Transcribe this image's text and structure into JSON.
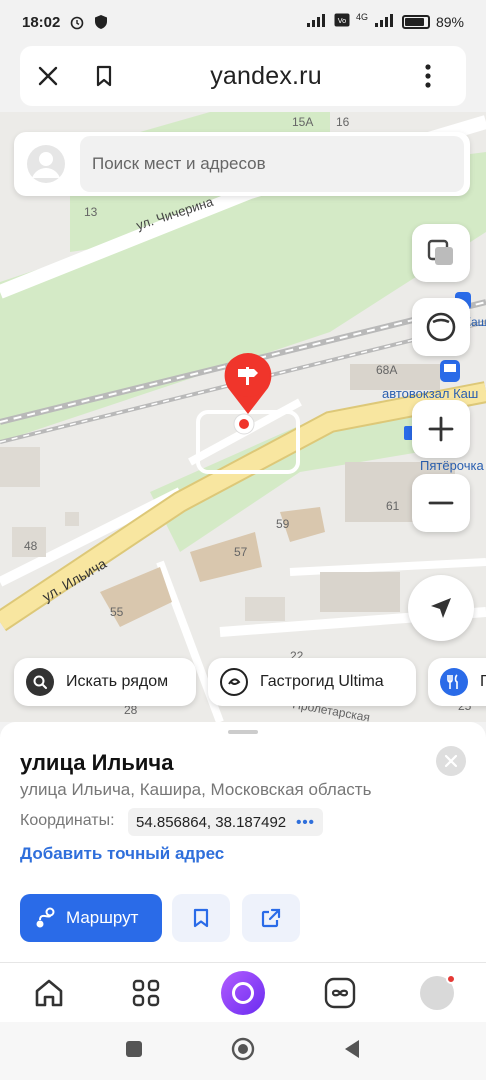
{
  "status_bar": {
    "time": "18:02",
    "network": "4G",
    "battery": "89%"
  },
  "browser": {
    "url": "yandex.ru"
  },
  "search": {
    "placeholder": "Поиск мест и адресов"
  },
  "map": {
    "labels": {
      "house_15a": "15А",
      "house_16": "16",
      "house_13": "13",
      "street_chicherina": "ул. Чичерина",
      "house_68a": "68А",
      "bus_station": "автовокзал Каш",
      "pyaterochka": "Пятёрочка",
      "house_61": "61",
      "house_59": "59",
      "house_57": "57",
      "house_48": "48",
      "street_ilyicha": "ул. Ильича",
      "house_55": "55",
      "house_22": "22",
      "house_28": "28",
      "house_25": "25",
      "street_proletarskaya": "Пролетарская",
      "kashira_top": "Каш"
    }
  },
  "chips": [
    {
      "label": "Искать рядом",
      "icon": "search-icon"
    },
    {
      "label": "Гастрогид Ultima",
      "icon": "gastro-guide-icon"
    },
    {
      "label": "П",
      "icon": "restaurant-icon"
    }
  ],
  "place": {
    "title": "улица Ильича",
    "subtitle": "улица Ильича, Кашира, Московская область",
    "coords_label": "Координаты:",
    "coords": "54.856864, 38.187492",
    "coords_more": "•••",
    "add_address": "Добавить точный адрес",
    "route_label": "Маршрут"
  },
  "colors": {
    "accent": "#2a6be8",
    "pin": "#f0352b",
    "road_yellow": "#f7e39a",
    "park_green": "#cfe8c1"
  }
}
